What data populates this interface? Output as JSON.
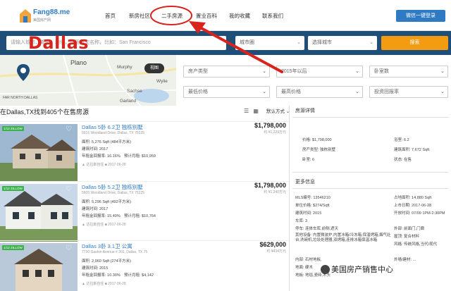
{
  "header": {
    "logo": {
      "text": "Fang88.me",
      "tagline": "美国房产网"
    },
    "nav": [
      "首页",
      "新房社区",
      "二手房源",
      "置业百科",
      "我的收藏",
      "联系我们"
    ],
    "wechat_login": "微信一键登录"
  },
  "searchbar": {
    "placeholder": "请输入城市、邮编、地址，或用英文名称，比如：San Francisco",
    "city_select": "城市圈",
    "city2_select": "选择城市",
    "search_button": "搜索"
  },
  "overlay_label": "Dallas",
  "map": {
    "labels": [
      "Plano",
      "Murphy",
      "Sachse",
      "Garland",
      "FAR NORTH DALLAS",
      "Wylie"
    ],
    "view_button": "视图"
  },
  "filters": {
    "row1": [
      "房产类型",
      "2015年以后",
      "卧室数"
    ],
    "row2": [
      "最低价格",
      "最高价格",
      "投资回报率"
    ]
  },
  "results": {
    "title": "在Dallas,TX找到405个在售房源",
    "sort": "默认方式"
  },
  "listings": [
    {
      "badge": "1/12 ZILLOW",
      "title": "Dallas 5卧 6.2卫 独栋别墅",
      "address": "5616 Woodland Drive, Dallas, TX 75225",
      "area": "面积: 5,276 Sqft (484平方米)",
      "year": "建筑时间: 2017",
      "return": "年租金回报率: 16.16%",
      "rent": "预计月租: $10,959",
      "meta": "▲ 达拉斯自住  ■ 2017-06-28",
      "price": "$1,798,000",
      "subprice": "约 ¥1,229万元"
    },
    {
      "badge": "1/12 ZILLOW",
      "title": "Dallas 5卧 5.2卫 独栋别墅",
      "address": "5605 Woodland Drive, Dallas, TX 75225",
      "area": "面积: 5,296 Sqft (492平方米)",
      "year": "建筑时间: 2017",
      "return": "年租金回报率: 15.40%",
      "rent": "预计月租: $10,764",
      "meta": "▲ 达拉斯自住  ■ 2017-06-28",
      "price": "$1,798,000",
      "subprice": "约 ¥1,240万元"
    },
    {
      "badge": "1/12 ZILLOW",
      "title": "Dallas 3卧 3.1卫 公寓",
      "address": "7730 Gaston Avenue # 301, Dallas, TX 75",
      "area": "面积: 2,960 Sqft (274平方米)",
      "year": "建筑时间: 2015",
      "return": "年租金回报率: 10.30%",
      "rent": "预计月租: $4,142",
      "meta": "▲ 达拉斯自住  ■ 2017-06-28",
      "price": "$629,000",
      "subprice": "约 ¥434万元"
    }
  ],
  "detail": {
    "title": "房源详情",
    "fields": [
      [
        "价格: $1,798,000",
        "浴室: 6.2"
      ],
      [
        "房产类型: 独栋别墅",
        "建筑面积: 7,672 Sqft"
      ],
      [
        "卧室: 6",
        "状态: 在售"
      ]
    ],
    "more_title": "更多信息",
    "more": [
      [
        "MLS编号: 13546210",
        "占地面积: 14,880 Sqft"
      ],
      [
        "单位价格: $274/Sqft",
        "上市日期: 2017-06-28"
      ],
      [
        "建筑时间: 2015",
        "开放时间: 07/09 1PM-2:30PM"
      ],
      [
        "车库: 3",
        ""
      ],
      [
        "停车: 连体车库,前侧,遮天",
        "外部: 前面门,门廊"
      ],
      [
        "其他设备: 内置微波炉,内置冰箱/冷冻箱,保温烤箱,烟气灶台,洗碗机,垃圾处理器,双烤箱,连排冰箱保温冰箱",
        "屋顶: 复合材料"
      ],
      [
        "",
        "风格: 传统风格,当代/现代"
      ],
      [
        "内部: 石材地板,",
        "外墙/建材: ..."
      ],
      [
        "地面: 硬木",
        ""
      ],
      [
        "地板: 地毯,瓷砖,木头",
        ""
      ]
    ]
  },
  "watermark": "美国房产销售中心",
  "colors": {
    "nav_blue": "#1f4e79",
    "accent_blue": "#2e7bc4",
    "search_orange": "#f39c12",
    "annotation_red": "#d9231d"
  }
}
